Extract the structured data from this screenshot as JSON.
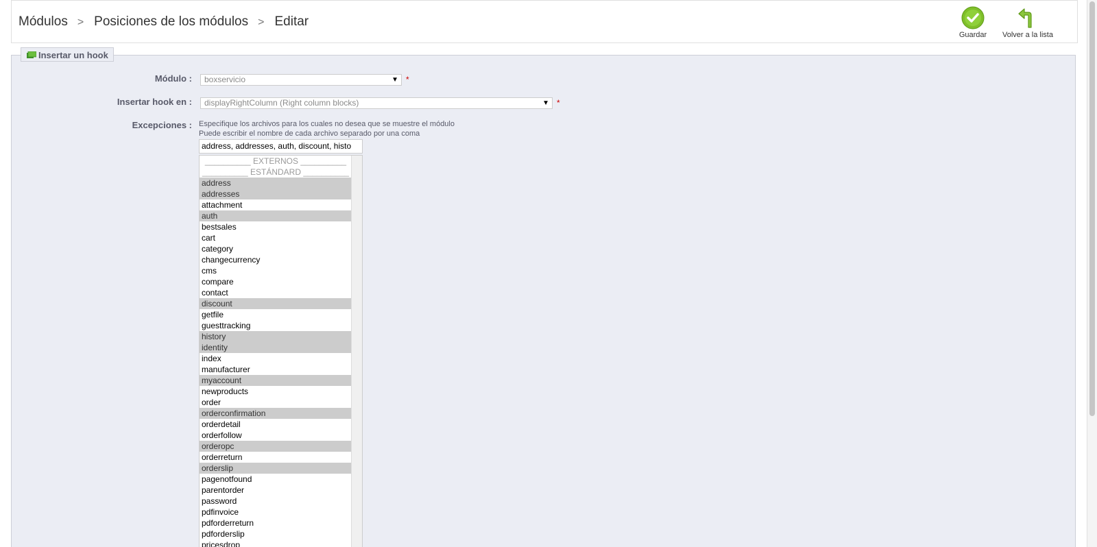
{
  "breadcrumb": {
    "items": [
      "Módulos",
      "Posiciones de los módulos",
      "Editar"
    ],
    "separator": ">"
  },
  "toolbar": {
    "save_label": "Guardar",
    "back_label": "Volver a la lista",
    "save_icon": "check-circle-icon",
    "back_icon": "return-arrow-icon",
    "accent_color": "#8cc63f"
  },
  "form": {
    "legend": "Insertar un hook",
    "legend_icon": "hook-icon",
    "module_label": "Módulo :",
    "module_value": "boxservicio",
    "hook_label": "Insertar hook en :",
    "hook_value": "displayRightColumn (Right column blocks)",
    "required_mark": "*",
    "exceptions_label": "Excepciones :",
    "hint_line1": "Especifique los archivos para los cuales no desea que se muestre el módulo",
    "hint_line2": "Puede escribir el nombre de cada archivo separado por una coma",
    "exceptions_value": "address, addresses, auth, discount, histo"
  },
  "exceptions_list": {
    "groups": [
      "__________ EXTERNOS __________",
      "__________ ESTÁNDARD __________"
    ],
    "items": [
      {
        "name": "address",
        "selected": true
      },
      {
        "name": "addresses",
        "selected": true
      },
      {
        "name": "attachment",
        "selected": false
      },
      {
        "name": "auth",
        "selected": true
      },
      {
        "name": "bestsales",
        "selected": false
      },
      {
        "name": "cart",
        "selected": false
      },
      {
        "name": "category",
        "selected": false
      },
      {
        "name": "changecurrency",
        "selected": false
      },
      {
        "name": "cms",
        "selected": false
      },
      {
        "name": "compare",
        "selected": false
      },
      {
        "name": "contact",
        "selected": false
      },
      {
        "name": "discount",
        "selected": true
      },
      {
        "name": "getfile",
        "selected": false
      },
      {
        "name": "guesttracking",
        "selected": false
      },
      {
        "name": "history",
        "selected": true
      },
      {
        "name": "identity",
        "selected": true
      },
      {
        "name": "index",
        "selected": false
      },
      {
        "name": "manufacturer",
        "selected": false
      },
      {
        "name": "myaccount",
        "selected": true
      },
      {
        "name": "newproducts",
        "selected": false
      },
      {
        "name": "order",
        "selected": false
      },
      {
        "name": "orderconfirmation",
        "selected": true
      },
      {
        "name": "orderdetail",
        "selected": false
      },
      {
        "name": "orderfollow",
        "selected": false
      },
      {
        "name": "orderopc",
        "selected": true
      },
      {
        "name": "orderreturn",
        "selected": false
      },
      {
        "name": "orderslip",
        "selected": true
      },
      {
        "name": "pagenotfound",
        "selected": false
      },
      {
        "name": "parentorder",
        "selected": false
      },
      {
        "name": "password",
        "selected": false
      },
      {
        "name": "pdfinvoice",
        "selected": false
      },
      {
        "name": "pdforderreturn",
        "selected": false
      },
      {
        "name": "pdforderslip",
        "selected": false
      },
      {
        "name": "pricesdrop",
        "selected": false
      }
    ]
  }
}
